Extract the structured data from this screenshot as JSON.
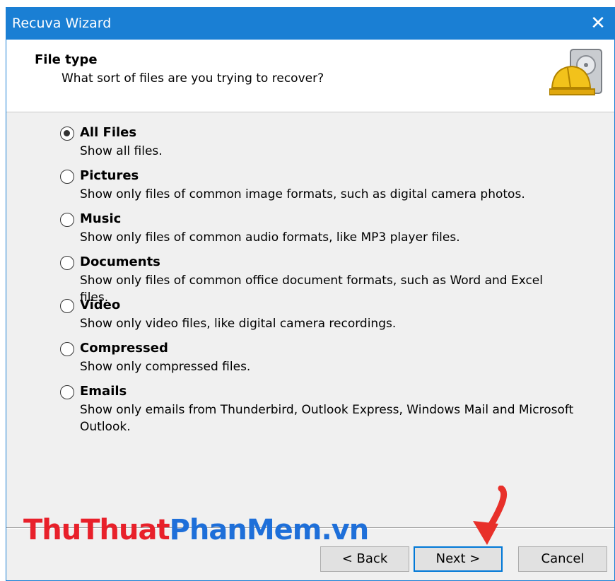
{
  "window": {
    "title": "Recuva Wizard",
    "close_glyph": "✕"
  },
  "header": {
    "title": "File type",
    "subtitle": "What sort of files are you trying to recover?",
    "icon": "recuva-hardhat-drive-icon"
  },
  "options": [
    {
      "label": "All Files",
      "description": "Show all files.",
      "checked": true
    },
    {
      "label": "Pictures",
      "description": "Show only files of common image formats, such as digital camera photos.",
      "checked": false
    },
    {
      "label": "Music",
      "description": "Show only files of common audio formats, like MP3 player files.",
      "checked": false
    },
    {
      "label": "Documents",
      "description": "Show only files of common office document formats, such as Word and Excel files.",
      "checked": false
    },
    {
      "label": "Video",
      "description": "Show only video files, like digital camera recordings.",
      "checked": false
    },
    {
      "label": "Compressed",
      "description": "Show only compressed files.",
      "checked": false
    },
    {
      "label": "Emails",
      "description": "Show only emails from Thunderbird, Outlook Express, Windows Mail and Microsoft Outlook.",
      "checked": false
    }
  ],
  "footer": {
    "back_label": "< Back",
    "next_label": "Next >",
    "cancel_label": "Cancel"
  },
  "watermark": {
    "part1": "ThuThuat",
    "part2": "PhanMem",
    "part3": ".vn"
  },
  "colors": {
    "titlebar": "#1a7fd4",
    "watermark_red": "#e8202a",
    "watermark_blue": "#1e6fd9",
    "arrow": "#e8302a"
  }
}
